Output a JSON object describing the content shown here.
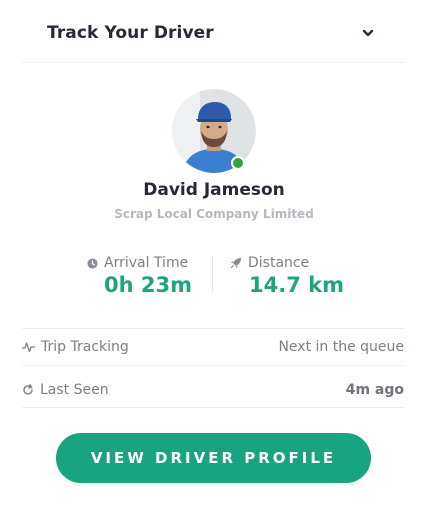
{
  "header": {
    "title": "Track Your Driver",
    "toggle_icon": "chevron-down-icon"
  },
  "driver": {
    "name": "David Jameson",
    "company": "Scrap Local Company Limited",
    "status": "online",
    "status_color": "#2fa33d"
  },
  "stats": {
    "arrival": {
      "icon": "clock-icon",
      "label": "Arrival Time",
      "value": "0h 23m"
    },
    "distance": {
      "icon": "rocket-icon",
      "label": "Distance",
      "value": "14.7 km"
    }
  },
  "rows": {
    "trip": {
      "icon": "activity-icon",
      "label": "Trip Tracking",
      "value": "Next in the queue"
    },
    "seen": {
      "icon": "refresh-icon",
      "label": "Last Seen",
      "value": "4m ago"
    }
  },
  "cta": {
    "label": "VIEW DRIVER PROFILE"
  },
  "colors": {
    "accent": "#18a381",
    "value_green": "#1ea580",
    "text_dark": "#262a36",
    "muted": "#7b7f88"
  }
}
